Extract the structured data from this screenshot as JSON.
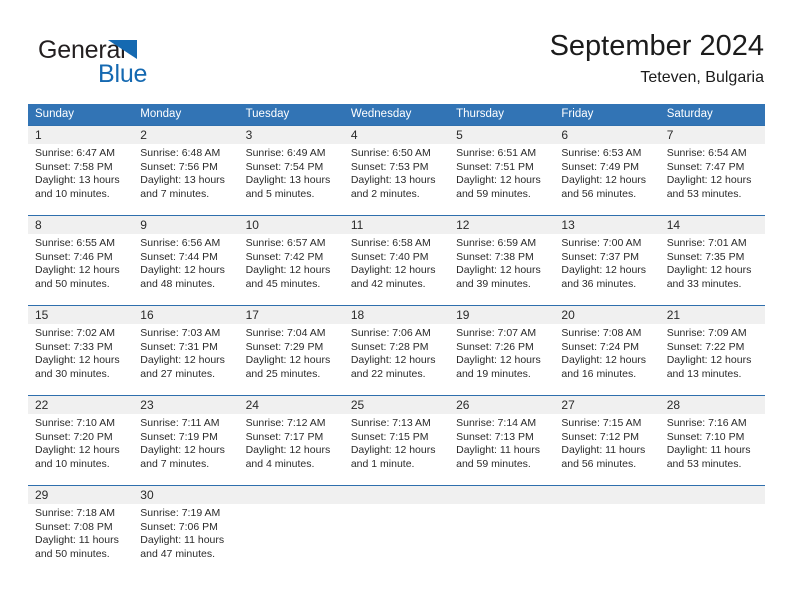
{
  "brand": {
    "name_part1": "General",
    "name_part2": "Blue",
    "triangle_color": "#1569b1"
  },
  "header": {
    "month_title": "September 2024",
    "location": "Teteven, Bulgaria",
    "accent_color": "#3274b5"
  },
  "weekday_headers": [
    "Sunday",
    "Monday",
    "Tuesday",
    "Wednesday",
    "Thursday",
    "Friday",
    "Saturday"
  ],
  "weeks": [
    [
      {
        "day": "1",
        "sunrise": "Sunrise: 6:47 AM",
        "sunset": "Sunset: 7:58 PM",
        "daylight_line1": "Daylight: 13 hours",
        "daylight_line2": "and 10 minutes."
      },
      {
        "day": "2",
        "sunrise": "Sunrise: 6:48 AM",
        "sunset": "Sunset: 7:56 PM",
        "daylight_line1": "Daylight: 13 hours",
        "daylight_line2": "and 7 minutes."
      },
      {
        "day": "3",
        "sunrise": "Sunrise: 6:49 AM",
        "sunset": "Sunset: 7:54 PM",
        "daylight_line1": "Daylight: 13 hours",
        "daylight_line2": "and 5 minutes."
      },
      {
        "day": "4",
        "sunrise": "Sunrise: 6:50 AM",
        "sunset": "Sunset: 7:53 PM",
        "daylight_line1": "Daylight: 13 hours",
        "daylight_line2": "and 2 minutes."
      },
      {
        "day": "5",
        "sunrise": "Sunrise: 6:51 AM",
        "sunset": "Sunset: 7:51 PM",
        "daylight_line1": "Daylight: 12 hours",
        "daylight_line2": "and 59 minutes."
      },
      {
        "day": "6",
        "sunrise": "Sunrise: 6:53 AM",
        "sunset": "Sunset: 7:49 PM",
        "daylight_line1": "Daylight: 12 hours",
        "daylight_line2": "and 56 minutes."
      },
      {
        "day": "7",
        "sunrise": "Sunrise: 6:54 AM",
        "sunset": "Sunset: 7:47 PM",
        "daylight_line1": "Daylight: 12 hours",
        "daylight_line2": "and 53 minutes."
      }
    ],
    [
      {
        "day": "8",
        "sunrise": "Sunrise: 6:55 AM",
        "sunset": "Sunset: 7:46 PM",
        "daylight_line1": "Daylight: 12 hours",
        "daylight_line2": "and 50 minutes."
      },
      {
        "day": "9",
        "sunrise": "Sunrise: 6:56 AM",
        "sunset": "Sunset: 7:44 PM",
        "daylight_line1": "Daylight: 12 hours",
        "daylight_line2": "and 48 minutes."
      },
      {
        "day": "10",
        "sunrise": "Sunrise: 6:57 AM",
        "sunset": "Sunset: 7:42 PM",
        "daylight_line1": "Daylight: 12 hours",
        "daylight_line2": "and 45 minutes."
      },
      {
        "day": "11",
        "sunrise": "Sunrise: 6:58 AM",
        "sunset": "Sunset: 7:40 PM",
        "daylight_line1": "Daylight: 12 hours",
        "daylight_line2": "and 42 minutes."
      },
      {
        "day": "12",
        "sunrise": "Sunrise: 6:59 AM",
        "sunset": "Sunset: 7:38 PM",
        "daylight_line1": "Daylight: 12 hours",
        "daylight_line2": "and 39 minutes."
      },
      {
        "day": "13",
        "sunrise": "Sunrise: 7:00 AM",
        "sunset": "Sunset: 7:37 PM",
        "daylight_line1": "Daylight: 12 hours",
        "daylight_line2": "and 36 minutes."
      },
      {
        "day": "14",
        "sunrise": "Sunrise: 7:01 AM",
        "sunset": "Sunset: 7:35 PM",
        "daylight_line1": "Daylight: 12 hours",
        "daylight_line2": "and 33 minutes."
      }
    ],
    [
      {
        "day": "15",
        "sunrise": "Sunrise: 7:02 AM",
        "sunset": "Sunset: 7:33 PM",
        "daylight_line1": "Daylight: 12 hours",
        "daylight_line2": "and 30 minutes."
      },
      {
        "day": "16",
        "sunrise": "Sunrise: 7:03 AM",
        "sunset": "Sunset: 7:31 PM",
        "daylight_line1": "Daylight: 12 hours",
        "daylight_line2": "and 27 minutes."
      },
      {
        "day": "17",
        "sunrise": "Sunrise: 7:04 AM",
        "sunset": "Sunset: 7:29 PM",
        "daylight_line1": "Daylight: 12 hours",
        "daylight_line2": "and 25 minutes."
      },
      {
        "day": "18",
        "sunrise": "Sunrise: 7:06 AM",
        "sunset": "Sunset: 7:28 PM",
        "daylight_line1": "Daylight: 12 hours",
        "daylight_line2": "and 22 minutes."
      },
      {
        "day": "19",
        "sunrise": "Sunrise: 7:07 AM",
        "sunset": "Sunset: 7:26 PM",
        "daylight_line1": "Daylight: 12 hours",
        "daylight_line2": "and 19 minutes."
      },
      {
        "day": "20",
        "sunrise": "Sunrise: 7:08 AM",
        "sunset": "Sunset: 7:24 PM",
        "daylight_line1": "Daylight: 12 hours",
        "daylight_line2": "and 16 minutes."
      },
      {
        "day": "21",
        "sunrise": "Sunrise: 7:09 AM",
        "sunset": "Sunset: 7:22 PM",
        "daylight_line1": "Daylight: 12 hours",
        "daylight_line2": "and 13 minutes."
      }
    ],
    [
      {
        "day": "22",
        "sunrise": "Sunrise: 7:10 AM",
        "sunset": "Sunset: 7:20 PM",
        "daylight_line1": "Daylight: 12 hours",
        "daylight_line2": "and 10 minutes."
      },
      {
        "day": "23",
        "sunrise": "Sunrise: 7:11 AM",
        "sunset": "Sunset: 7:19 PM",
        "daylight_line1": "Daylight: 12 hours",
        "daylight_line2": "and 7 minutes."
      },
      {
        "day": "24",
        "sunrise": "Sunrise: 7:12 AM",
        "sunset": "Sunset: 7:17 PM",
        "daylight_line1": "Daylight: 12 hours",
        "daylight_line2": "and 4 minutes."
      },
      {
        "day": "25",
        "sunrise": "Sunrise: 7:13 AM",
        "sunset": "Sunset: 7:15 PM",
        "daylight_line1": "Daylight: 12 hours",
        "daylight_line2": "and 1 minute."
      },
      {
        "day": "26",
        "sunrise": "Sunrise: 7:14 AM",
        "sunset": "Sunset: 7:13 PM",
        "daylight_line1": "Daylight: 11 hours",
        "daylight_line2": "and 59 minutes."
      },
      {
        "day": "27",
        "sunrise": "Sunrise: 7:15 AM",
        "sunset": "Sunset: 7:12 PM",
        "daylight_line1": "Daylight: 11 hours",
        "daylight_line2": "and 56 minutes."
      },
      {
        "day": "28",
        "sunrise": "Sunrise: 7:16 AM",
        "sunset": "Sunset: 7:10 PM",
        "daylight_line1": "Daylight: 11 hours",
        "daylight_line2": "and 53 minutes."
      }
    ],
    [
      {
        "day": "29",
        "sunrise": "Sunrise: 7:18 AM",
        "sunset": "Sunset: 7:08 PM",
        "daylight_line1": "Daylight: 11 hours",
        "daylight_line2": "and 50 minutes."
      },
      {
        "day": "30",
        "sunrise": "Sunrise: 7:19 AM",
        "sunset": "Sunset: 7:06 PM",
        "daylight_line1": "Daylight: 11 hours",
        "daylight_line2": "and 47 minutes."
      },
      {
        "day": "",
        "sunrise": "",
        "sunset": "",
        "daylight_line1": "",
        "daylight_line2": ""
      },
      {
        "day": "",
        "sunrise": "",
        "sunset": "",
        "daylight_line1": "",
        "daylight_line2": ""
      },
      {
        "day": "",
        "sunrise": "",
        "sunset": "",
        "daylight_line1": "",
        "daylight_line2": ""
      },
      {
        "day": "",
        "sunrise": "",
        "sunset": "",
        "daylight_line1": "",
        "daylight_line2": ""
      },
      {
        "day": "",
        "sunrise": "",
        "sunset": "",
        "daylight_line1": "",
        "daylight_line2": ""
      }
    ]
  ]
}
